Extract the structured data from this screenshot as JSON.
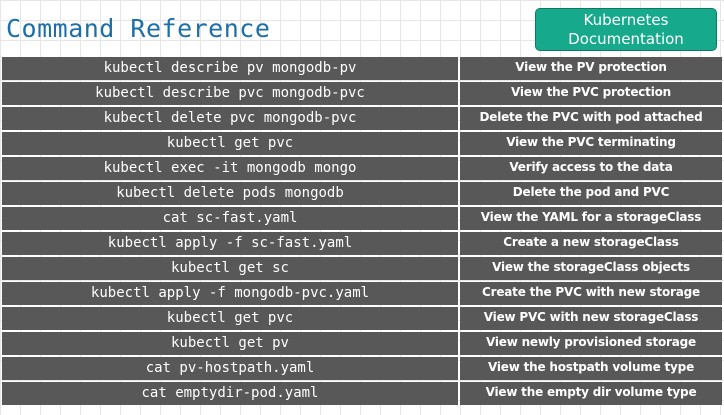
{
  "header": {
    "title": "Command Reference",
    "docs_button": {
      "line1": "Kubernetes",
      "line2": "Documentation"
    }
  },
  "commands": [
    {
      "cmd": "kubectl describe pv mongodb-pv",
      "desc": "View the PV protection"
    },
    {
      "cmd": "kubectl describe pvc mongodb-pvc",
      "desc": "View the PVC protection"
    },
    {
      "cmd": "kubectl delete pvc mongodb-pvc",
      "desc": "Delete the PVC with pod attached"
    },
    {
      "cmd": "kubectl get pvc",
      "desc": "View the PVC terminating"
    },
    {
      "cmd": "kubectl exec -it mongodb mongo",
      "desc": "Verify access to the data"
    },
    {
      "cmd": "kubectl delete pods mongodb",
      "desc": "Delete the pod and PVC"
    },
    {
      "cmd": "cat sc-fast.yaml",
      "desc": "View the YAML for a storageClass"
    },
    {
      "cmd": "kubectl apply -f sc-fast.yaml",
      "desc": "Create a new storageClass"
    },
    {
      "cmd": "kubectl get sc",
      "desc": "View the storageClass objects"
    },
    {
      "cmd": "kubectl apply -f mongodb-pvc.yaml",
      "desc": "Create the PVC with new storage"
    },
    {
      "cmd": "kubectl get pvc",
      "desc": "View PVC with new storageClass"
    },
    {
      "cmd": "kubectl get pv",
      "desc": "View newly provisioned storage"
    },
    {
      "cmd": "cat pv-hostpath.yaml",
      "desc": "View the hostpath volume type"
    },
    {
      "cmd": "cat emptydir-pod.yaml",
      "desc": "View the empty dir volume type"
    }
  ],
  "colors": {
    "title": "#1c6fa8",
    "button": "#17a98b",
    "row_bg": "#585858",
    "row_text": "#ffffff"
  }
}
